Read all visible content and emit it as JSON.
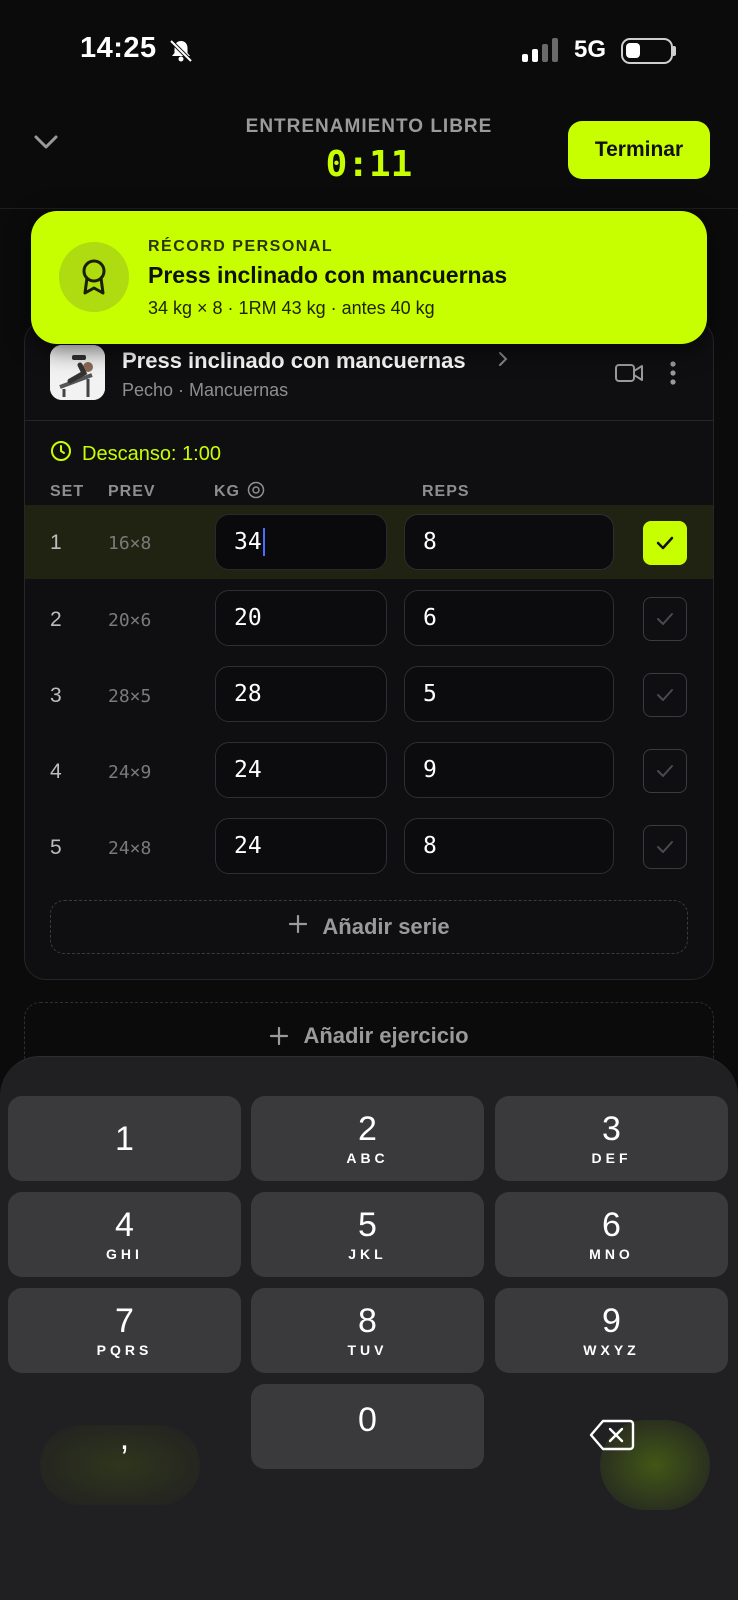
{
  "status_bar": {
    "time": "14:25",
    "network": "5G"
  },
  "header": {
    "title": "ENTRENAMIENTO LIBRE",
    "timer": "0:11",
    "finish_label": "Terminar"
  },
  "toast": {
    "kicker": "RÉCORD PERSONAL",
    "title": "Press inclinado con mancuernas",
    "detail": "34 kg × 8 · 1RM 43 kg · antes 40 kg"
  },
  "exercise": {
    "name": "Press inclinado con mancuernas",
    "subtitle": "Pecho · Mancuernas",
    "rest_label": "Descanso: 1:00",
    "columns": {
      "set": "SET",
      "prev": "PREV",
      "kg": "KG",
      "reps": "REPS"
    },
    "sets": [
      {
        "set": "1",
        "prev": "16×8",
        "kg": "34",
        "reps": "8",
        "done": true
      },
      {
        "set": "2",
        "prev": "20×6",
        "kg": "20",
        "reps": "6",
        "done": false
      },
      {
        "set": "3",
        "prev": "28×5",
        "kg": "28",
        "reps": "5",
        "done": false
      },
      {
        "set": "4",
        "prev": "24×9",
        "kg": "24",
        "reps": "9",
        "done": false
      },
      {
        "set": "5",
        "prev": "24×8",
        "kg": "24",
        "reps": "8",
        "done": false
      }
    ],
    "add_set_label": "Añadir serie"
  },
  "add_exercise_label": "Añadir ejercicio",
  "keypad": {
    "keys": [
      {
        "digit": "1",
        "letters": ""
      },
      {
        "digit": "2",
        "letters": "ABC"
      },
      {
        "digit": "3",
        "letters": "DEF"
      },
      {
        "digit": "4",
        "letters": "GHI"
      },
      {
        "digit": "5",
        "letters": "JKL"
      },
      {
        "digit": "6",
        "letters": "MNO"
      },
      {
        "digit": "7",
        "letters": "PQRS"
      },
      {
        "digit": "8",
        "letters": "TUV"
      },
      {
        "digit": "9",
        "letters": "WXYZ"
      }
    ],
    "comma": ",",
    "zero": "0"
  },
  "colors": {
    "accent": "#c8ff00",
    "background": "#0b0b0c",
    "keypad": "#202022",
    "key": "#3a3a3c"
  },
  "icons": {
    "chevron": "chevron-down-icon",
    "badge": "award-ribbon-icon",
    "video": "video-camera-icon",
    "more": "more-vertical-icon",
    "clock": "clock-icon",
    "plus": "plus-icon",
    "check": "checkmark-icon",
    "backspace": "backspace-icon"
  }
}
